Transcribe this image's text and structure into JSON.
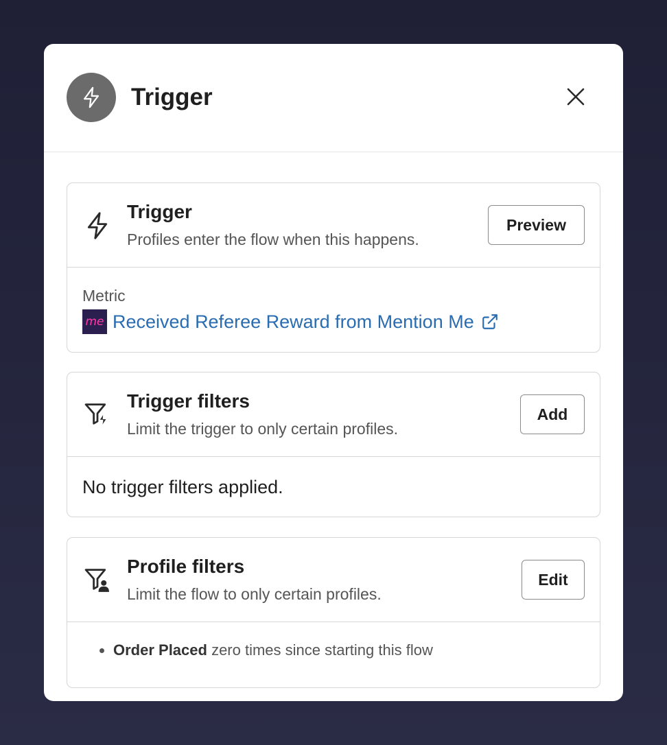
{
  "modal": {
    "title": "Trigger",
    "header_icon": "lightning-bolt-icon",
    "close_icon": "close-icon"
  },
  "trigger_card": {
    "title": "Trigger",
    "description": "Profiles enter the flow when this happens.",
    "button_label": "Preview",
    "icon": "lightning-bolt-icon",
    "metric_label": "Metric",
    "metric_logo_text": "me",
    "metric_name": "Received Referee Reward from Mention Me",
    "metric_link_icon": "external-link-icon"
  },
  "trigger_filters_card": {
    "title": "Trigger filters",
    "description": "Limit the trigger to only certain profiles.",
    "button_label": "Add",
    "icon": "filter-lightning-icon",
    "empty_text": "No trigger filters applied."
  },
  "profile_filters_card": {
    "title": "Profile filters",
    "description": "Limit the flow to only certain profiles.",
    "button_label": "Edit",
    "icon": "filter-person-icon",
    "items": [
      {
        "bold": "Order Placed",
        "rest": " zero times since starting this flow"
      }
    ]
  },
  "colors": {
    "backdrop": "#23243b",
    "link": "#2a6cb0",
    "header_icon_bg": "#6b6b6b",
    "mention_me_logo_bg": "#2a1f4f",
    "mention_me_logo_text": "#ff3ca8"
  }
}
